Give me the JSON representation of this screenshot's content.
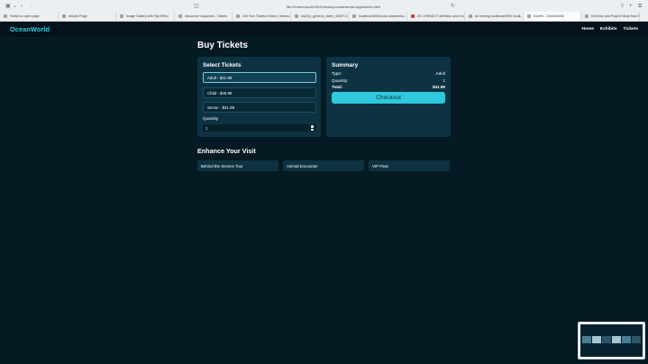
{
  "browser": {
    "url": "file:///Users/rsc5/0/0/2/desktop/oceanworld-app/tickets.html",
    "tabs": [
      {
        "label": "Switch to open page",
        "active": false
      },
      {
        "label": "Articles Page",
        "active": false
      },
      {
        "label": "Image Gallery with Flip Effect",
        "active": false
      },
      {
        "label": "Vancouver Aquarium - Tickets",
        "active": false
      },
      {
        "label": "Get Your Tickets Online | Vancou...",
        "active": false
      },
      {
        "label": "clip2(1)_general_video_40007-0...",
        "active": false
      },
      {
        "label": "localhost:8000/code-session/ca...",
        "active": false
      },
      {
        "label": "VS CONNECT definition and mea...",
        "active": false
      },
      {
        "label": "do running localhost:8000 locali...",
        "active": false
      },
      {
        "label": "Tickets - OceanWorld",
        "active": true
      },
      {
        "label": "Exercise and Project Ideas from Batwo...",
        "active": false
      }
    ]
  },
  "site": {
    "logo": "OceanWorld",
    "nav": [
      "Home",
      "Exhibits",
      "Tickets"
    ]
  },
  "page": {
    "title": "Buy Tickets"
  },
  "select": {
    "title": "Select Tickets",
    "options": [
      {
        "label": "Adult - $41.99",
        "selected": true
      },
      {
        "label": "Child - $28.99",
        "selected": false
      },
      {
        "label": "Senior - $31.99",
        "selected": false
      }
    ],
    "quantity_label": "Quantity",
    "quantity_value": "1"
  },
  "summary": {
    "title": "Summary",
    "type_label": "Type:",
    "type_value": "Adult",
    "quantity_label": "Quantity:",
    "quantity_value": "1",
    "total_label": "Total:",
    "total_value": "$41.99",
    "checkout_label": "Checkout"
  },
  "enhance": {
    "title": "Enhance Your Visit",
    "addons": [
      "Behind the Scenes Tour",
      "Animal Encounter",
      "VIP Pass"
    ]
  },
  "colors": {
    "background": "#061a24",
    "accent": "#2ec9dd",
    "card": "#0d3343"
  }
}
